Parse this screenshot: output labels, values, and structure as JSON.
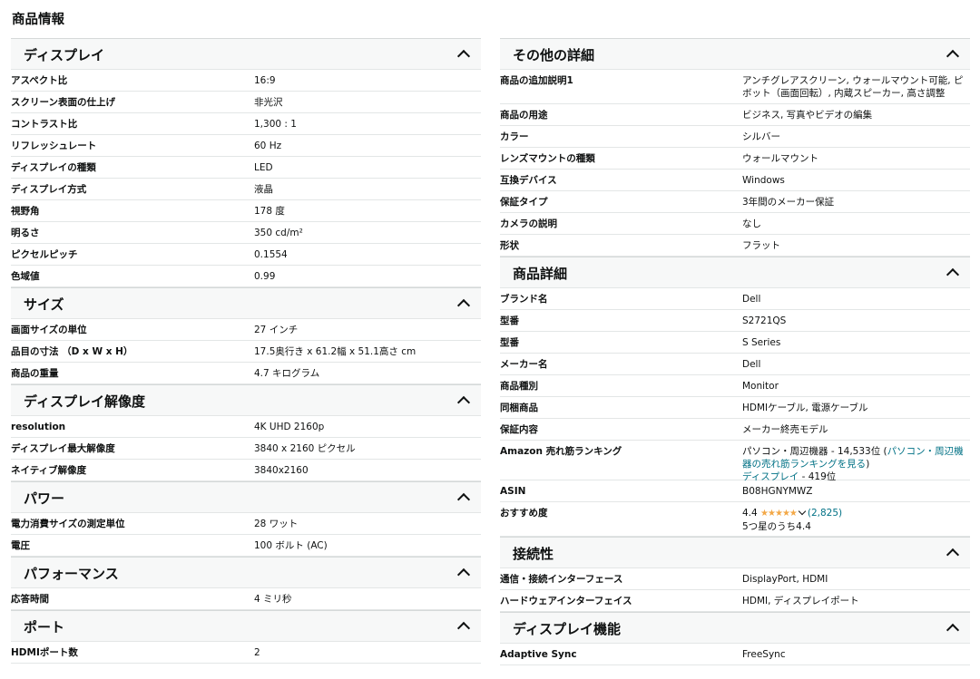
{
  "page_title": "商品情報",
  "left_sections": [
    {
      "title": "ディスプレイ",
      "rows": [
        {
          "k": "アスペクト比",
          "v": "16:9"
        },
        {
          "k": "スクリーン表面の仕上げ",
          "v": "非光沢"
        },
        {
          "k": "コントラスト比",
          "v": "1,300 : 1"
        },
        {
          "k": "リフレッシュレート",
          "v": "60 Hz"
        },
        {
          "k": "ディスプレイの種類",
          "v": "LED"
        },
        {
          "k": "ディスプレイ方式",
          "v": "液晶"
        },
        {
          "k": "視野角",
          "v": "178 度"
        },
        {
          "k": "明るさ",
          "v": "350 cd/m²"
        },
        {
          "k": "ピクセルピッチ",
          "v": "0.1554"
        },
        {
          "k": "色域値",
          "v": "0.99"
        }
      ]
    },
    {
      "title": "サイズ",
      "rows": [
        {
          "k": "画面サイズの単位",
          "v": "27 インチ"
        },
        {
          "k": "品目の寸法 （D x W x H）",
          "v": "17.5奥行き x 61.2幅 x 51.1高さ cm"
        },
        {
          "k": "商品の重量",
          "v": "4.7 キログラム"
        }
      ]
    },
    {
      "title": "ディスプレイ解像度",
      "rows": [
        {
          "k": "resolution",
          "v": "4K UHD 2160p"
        },
        {
          "k": "ディスプレイ最大解像度",
          "v": "3840 x 2160 ピクセル"
        },
        {
          "k": "ネイティブ解像度",
          "v": "3840x2160"
        }
      ]
    },
    {
      "title": "パワー",
      "rows": [
        {
          "k": "電力消費サイズの測定単位",
          "v": "28 ワット"
        },
        {
          "k": "電圧",
          "v": "100 ボルト (AC)"
        }
      ]
    },
    {
      "title": "パフォーマンス",
      "rows": [
        {
          "k": "応答時間",
          "v": "4 ミリ秒"
        }
      ]
    },
    {
      "title": "ポート",
      "rows": [
        {
          "k": "HDMIポート数",
          "v": "2"
        }
      ]
    }
  ],
  "right_sections": [
    {
      "title": "その他の詳細",
      "rows": [
        {
          "k": "商品の追加説明1",
          "v": "アンチグレアスクリーン, ウォールマウント可能, ピボット（画面回転）, 内蔵スピーカー, 高さ調整"
        },
        {
          "k": "商品の用途",
          "v": "ビジネス, 写真やビデオの編集"
        },
        {
          "k": "カラー",
          "v": "シルバー"
        },
        {
          "k": "レンズマウントの種類",
          "v": "ウォールマウント"
        },
        {
          "k": "互換デバイス",
          "v": "Windows"
        },
        {
          "k": "保証タイプ",
          "v": "3年間のメーカー保証"
        },
        {
          "k": "カメラの説明",
          "v": "なし"
        },
        {
          "k": "形状",
          "v": "フラット"
        }
      ]
    },
    {
      "title": "商品詳細",
      "rows": [
        {
          "k": "ブランド名",
          "v": "Dell"
        },
        {
          "k": "型番",
          "v": "S2721QS"
        },
        {
          "k": "型番",
          "v": "S Series"
        },
        {
          "k": "メーカー名",
          "v": "Dell"
        },
        {
          "k": "商品種別",
          "v": "Monitor"
        },
        {
          "k": "同梱商品",
          "v": "HDMIケーブル, 電源ケーブル"
        },
        {
          "k": "保証内容",
          "v": "メーカー終売モデル"
        }
      ]
    },
    {
      "title": "接続性",
      "rows": [
        {
          "k": "通信・接続インターフェース",
          "v": "DisplayPort, HDMI"
        },
        {
          "k": "ハードウェアインターフェイス",
          "v": "HDMI, ディスプレイポート"
        }
      ]
    },
    {
      "title": "ディスプレイ機能",
      "rows": [
        {
          "k": "Adaptive Sync",
          "v": "FreeSync"
        }
      ]
    }
  ],
  "ranking": {
    "key": "Amazon 売れ筋ランキング",
    "cat1_text": "パソコン・周辺機器 - 14,533位 (",
    "cat1_link": "パソコン・周辺機器の売れ筋ランキングを見る",
    "cat1_close": ")",
    "cat2_link": "ディスプレイ",
    "cat2_text": " - 419位"
  },
  "asin": {
    "key": "ASIN",
    "value": "B08HGNYMWZ"
  },
  "rating": {
    "key": "おすすめ度",
    "score": "4.4",
    "stars_value": 4.4,
    "stars_glyphs": "★★★★★",
    "count": "(2,825)",
    "out_of": "5つ星のうち4.4"
  },
  "colors": {
    "link": "#007185",
    "star": "#f3a847",
    "header_bg": "#f7f8f8"
  }
}
